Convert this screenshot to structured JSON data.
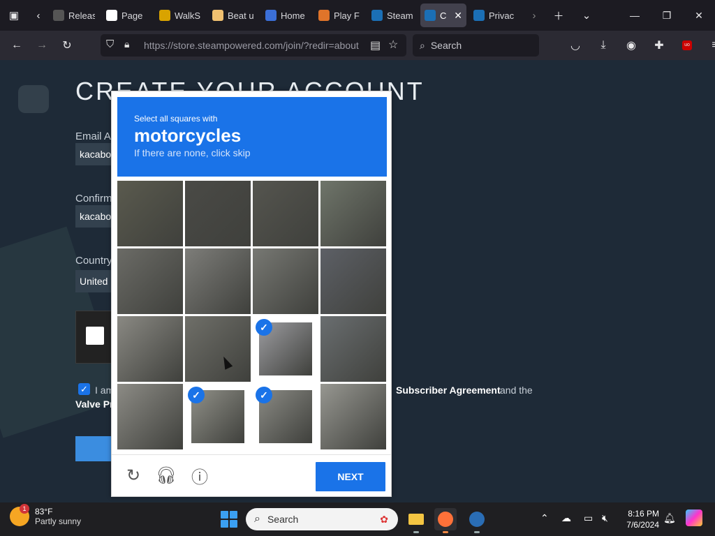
{
  "browser": {
    "tabs": [
      {
        "label": "Releas",
        "icon": "document-icon"
      },
      {
        "label": "Page",
        "icon": "github-icon"
      },
      {
        "label": "WalkS",
        "icon": "walkthrough-icon"
      },
      {
        "label": "Beat u",
        "icon": "game-icon"
      },
      {
        "label": "Home",
        "icon": "monitor-icon"
      },
      {
        "label": "Play F",
        "icon": "fox-icon"
      },
      {
        "label": "Steam",
        "icon": "steam-icon"
      },
      {
        "label": "Cre",
        "icon": "steam-icon",
        "active": true
      },
      {
        "label": "Privac",
        "icon": "steam-icon"
      }
    ],
    "url": "https://store.steampowered.com/join/?redir=about",
    "search_placeholder": "Search"
  },
  "page": {
    "title": "CREATE YOUR ACCOUNT",
    "email_label": "Email Ac",
    "email_value": "kacabo",
    "confirm_label": "Confirm",
    "confirm_value": "kacabo",
    "country_label": "Country",
    "country_value": "United",
    "agree_prefix": "I am",
    "agree_link": "Subscriber Agreement",
    "agree_suffix": "and the",
    "privacy_link": "Valve Pr"
  },
  "captcha": {
    "instruction": "Select all squares with",
    "target": "motorcycles",
    "hint": "If there are none, click skip",
    "next_label": "NEXT",
    "selected": [
      false,
      false,
      false,
      false,
      false,
      false,
      false,
      false,
      false,
      false,
      true,
      false,
      false,
      true,
      true,
      false
    ]
  },
  "taskbar": {
    "temp": "83°F",
    "weather": "Partly sunny",
    "weather_badge": "1",
    "search_placeholder": "Search",
    "time": "8:16 PM",
    "date": "7/6/2024"
  },
  "colors": {
    "captcha_blue": "#1a73e8",
    "steam_bg": "#1e2a37"
  }
}
